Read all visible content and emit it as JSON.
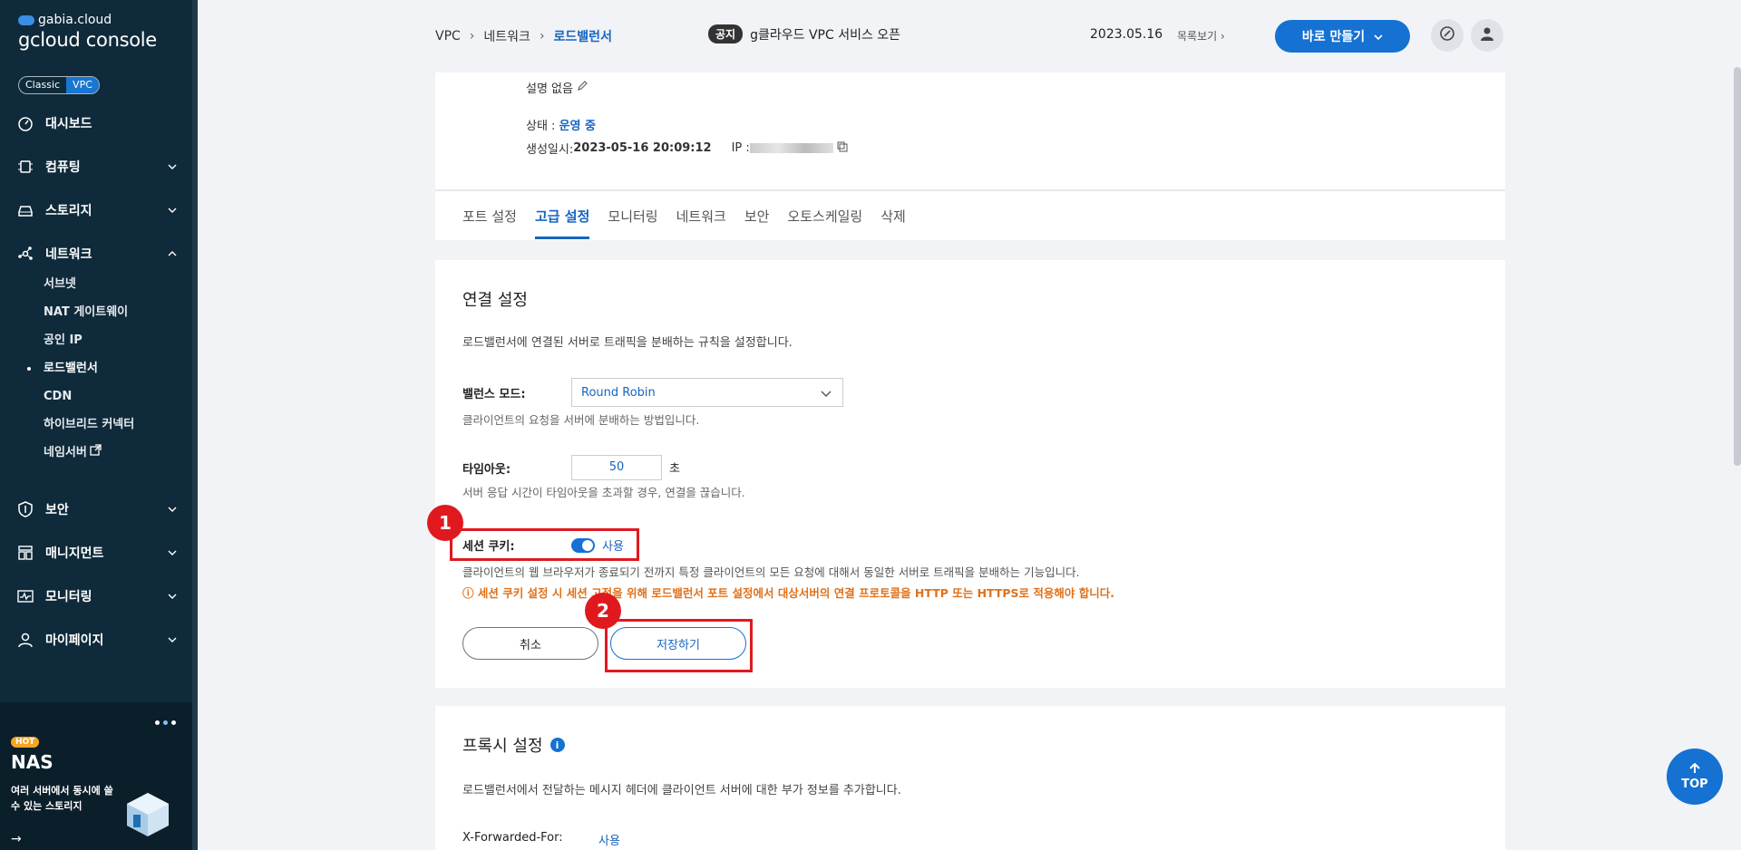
{
  "sidebar": {
    "logo_top": "gabia.cloud",
    "logo_main": "gcloud console",
    "toggle": {
      "classic": "Classic",
      "vpc": "VPC"
    },
    "items": [
      {
        "label": "대시보드",
        "icon": "dashboard-icon"
      },
      {
        "label": "컴퓨팅",
        "icon": "chip-icon"
      },
      {
        "label": "스토리지",
        "icon": "storage-icon"
      },
      {
        "label": "네트워크",
        "icon": "network-icon"
      },
      {
        "label": "보안",
        "icon": "shield-icon"
      },
      {
        "label": "매니지먼트",
        "icon": "management-icon"
      },
      {
        "label": "모니터링",
        "icon": "monitor-icon"
      },
      {
        "label": "마이페이지",
        "icon": "user-icon"
      }
    ],
    "network_sub": [
      {
        "label": "서브넷"
      },
      {
        "label": "NAT 게이트웨이"
      },
      {
        "label": "공인 IP"
      },
      {
        "label": "로드밸런서"
      },
      {
        "label": "CDN"
      },
      {
        "label": "하이브리드 커넥터"
      },
      {
        "label": "네임서버"
      }
    ],
    "promo": {
      "hot": "HOT",
      "title": "NAS",
      "desc": "여러 서버에서 동시에 쓸 수 있는 스토리지"
    }
  },
  "header": {
    "breadcrumb": [
      "VPC",
      "네트워크",
      "로드밸런서"
    ],
    "notice_badge": "공지",
    "notice_text": "g클라우드 VPC 서비스 오픈",
    "date": "2023.05.16",
    "list_link": "목록보기",
    "make_button": "바로 만들기"
  },
  "summary": {
    "desc": "설명 없음",
    "status_label": "상태 : ",
    "status_value": "운영 중",
    "created_label": "생성일시: ",
    "created_value": "2023-05-16 20:09:12",
    "ip_label": "IP : "
  },
  "tabs": [
    "포트 설정",
    "고급 설정",
    "모니터링",
    "네트워크",
    "보안",
    "오토스케일링",
    "삭제"
  ],
  "connection": {
    "title": "연결 설정",
    "desc": "로드밸런서에 연결된 서버로 트래픽을 분배하는 규칙을 설정합니다.",
    "balance_label": "밸런스 모드:",
    "balance_value": "Round Robin",
    "balance_hint": "클라이언트의 요청을 서버에 분배하는 방법입니다.",
    "timeout_label": "타임아웃:",
    "timeout_value": "50",
    "timeout_unit": "초",
    "timeout_hint": "서버 응답 시간이 타임아웃을 초과할 경우, 연결을 끊습니다.",
    "cookie_label": "세션 쿠키:",
    "cookie_state": "사용",
    "cookie_hint": "클라이언트의 웹 브라우저가 종료되기 전까지 특정 클라이언트의 모든 요청에 대해서 동일한 서버로 트래픽을 분배하는 기능입니다.",
    "warning": "ⓘ 세션 쿠키 설정 시 세션 고정을 위해 로드밸런서 포트 설정에서 대상서버의 연결 프로토콜을 HTTP 또는 HTTPS로 적용해야 합니다.",
    "cancel": "취소",
    "save": "저장하기"
  },
  "proxy": {
    "title": "프록시 설정",
    "desc": "로드밸런서에서 전달하는 메시지 헤더에 클라이언트 서버에 대한 부가 정보를 추가합니다.",
    "xff_label": "X-Forwarded-For:",
    "xff_value": "사용"
  },
  "steps": [
    "1",
    "2"
  ],
  "top_button": "TOP"
}
